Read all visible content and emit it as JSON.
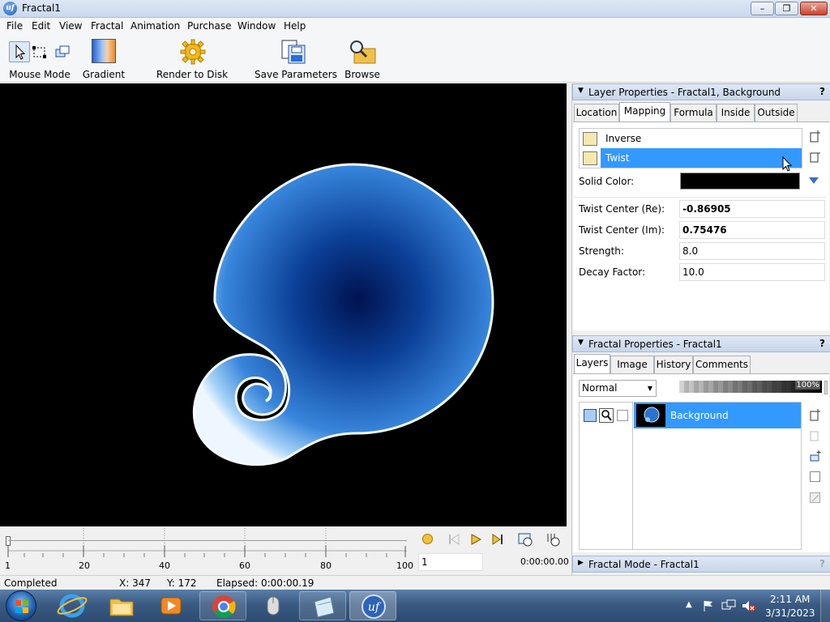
{
  "window": {
    "title": "Fractal1",
    "app_icon": "uf"
  },
  "caption": {
    "minimize": "–",
    "maximize": "❐",
    "close": "✕"
  },
  "menu": [
    "File",
    "Edit",
    "View",
    "Fractal",
    "Animation",
    "Purchase",
    "Window",
    "Help"
  ],
  "toolbar": {
    "mouse_mode": "Mouse Mode",
    "gradient": "Gradient",
    "render": "Render to Disk",
    "save_params": "Save Parameters",
    "browse": "Browse"
  },
  "timeline": {
    "ticks": [
      "1",
      "20",
      "40",
      "60",
      "80",
      "100"
    ],
    "frame": "1",
    "time": "0:00:00.00"
  },
  "layer_props": {
    "title": "Layer Properties - Fractal1, Background",
    "help": "?",
    "tabs": [
      "Location",
      "Mapping",
      "Formula",
      "Inside",
      "Outside"
    ],
    "active_tab": "Mapping",
    "mappings": [
      "Inverse",
      "Twist"
    ],
    "selected_mapping": "Twist",
    "solid_color_label": "Solid Color:",
    "solid_color": "#000000",
    "params": [
      {
        "label": "Twist Center (Re):",
        "value": "-0.86905",
        "bold": true
      },
      {
        "label": "Twist Center (Im):",
        "value": "0.75476",
        "bold": true
      },
      {
        "label": "Strength:",
        "value": "8.0",
        "bold": false
      },
      {
        "label": "Decay Factor:",
        "value": "10.0",
        "bold": false
      }
    ]
  },
  "fractal_props": {
    "title": "Fractal Properties - Fractal1",
    "help": "?",
    "tabs": [
      "Layers",
      "Image",
      "History",
      "Comments"
    ],
    "active_tab": "Layers",
    "blend_mode": "Normal",
    "opacity": "100%",
    "opacity_fraction": 1.0,
    "layer_name": "Background"
  },
  "fractal_mode": {
    "title": "Fractal Mode - Fractal1",
    "help": "?"
  },
  "status": {
    "state": "Completed",
    "x": "X: 347",
    "y": "Y: 172",
    "elapsed": "Elapsed: 0:00:00.19"
  },
  "clock": {
    "time": "2:11 AM",
    "date": "3/31/2023"
  },
  "colors": {
    "selection": "#3399ff",
    "fractal_light": "#8fc4f6",
    "fractal_mid": "#2a73cc",
    "fractal_dark": "#001a5c"
  }
}
